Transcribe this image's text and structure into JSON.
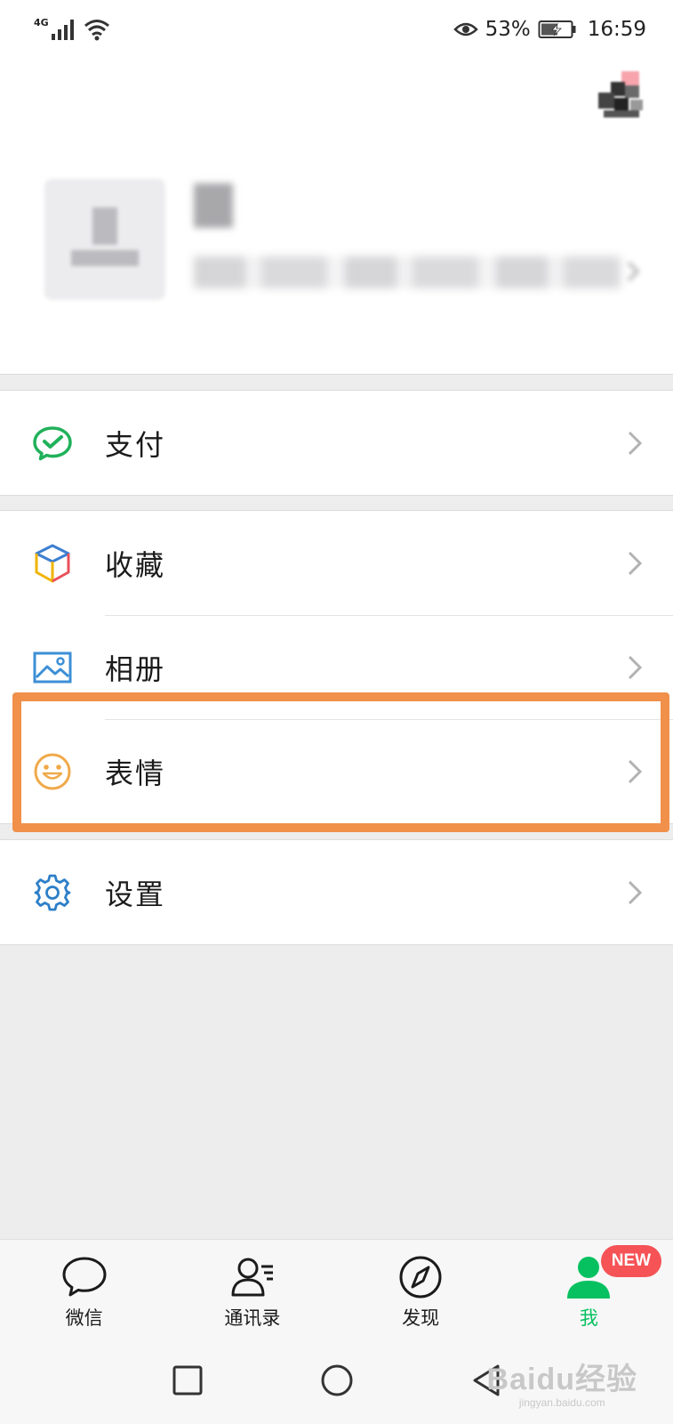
{
  "status_bar": {
    "network": "4G",
    "battery_percent": "53%",
    "time": "16:59"
  },
  "profile": {
    "nickname": "",
    "wechat_id": ""
  },
  "menu": {
    "pay": {
      "label": "支付",
      "icon": "wechat-pay-icon"
    },
    "favorites": {
      "label": "收藏",
      "icon": "favorites-cube-icon"
    },
    "album": {
      "label": "相册",
      "icon": "album-image-icon"
    },
    "stickers": {
      "label": "表情",
      "icon": "sticker-smile-icon"
    },
    "settings": {
      "label": "设置",
      "icon": "gear-icon"
    }
  },
  "tabs": [
    {
      "label": "微信",
      "icon": "chat-bubble-icon",
      "active": false
    },
    {
      "label": "通讯录",
      "icon": "contacts-icon",
      "active": false
    },
    {
      "label": "发现",
      "icon": "compass-icon",
      "active": false
    },
    {
      "label": "我",
      "icon": "me-person-icon",
      "active": true,
      "badge": "NEW"
    }
  ],
  "watermark": {
    "logo": "Baidu经验",
    "site": "jingyan.baidu.com"
  },
  "colors": {
    "wechat_green": "#07c160",
    "highlight_orange": "#f0904b",
    "badge_red": "#f55356",
    "page_bg": "#ededed"
  }
}
